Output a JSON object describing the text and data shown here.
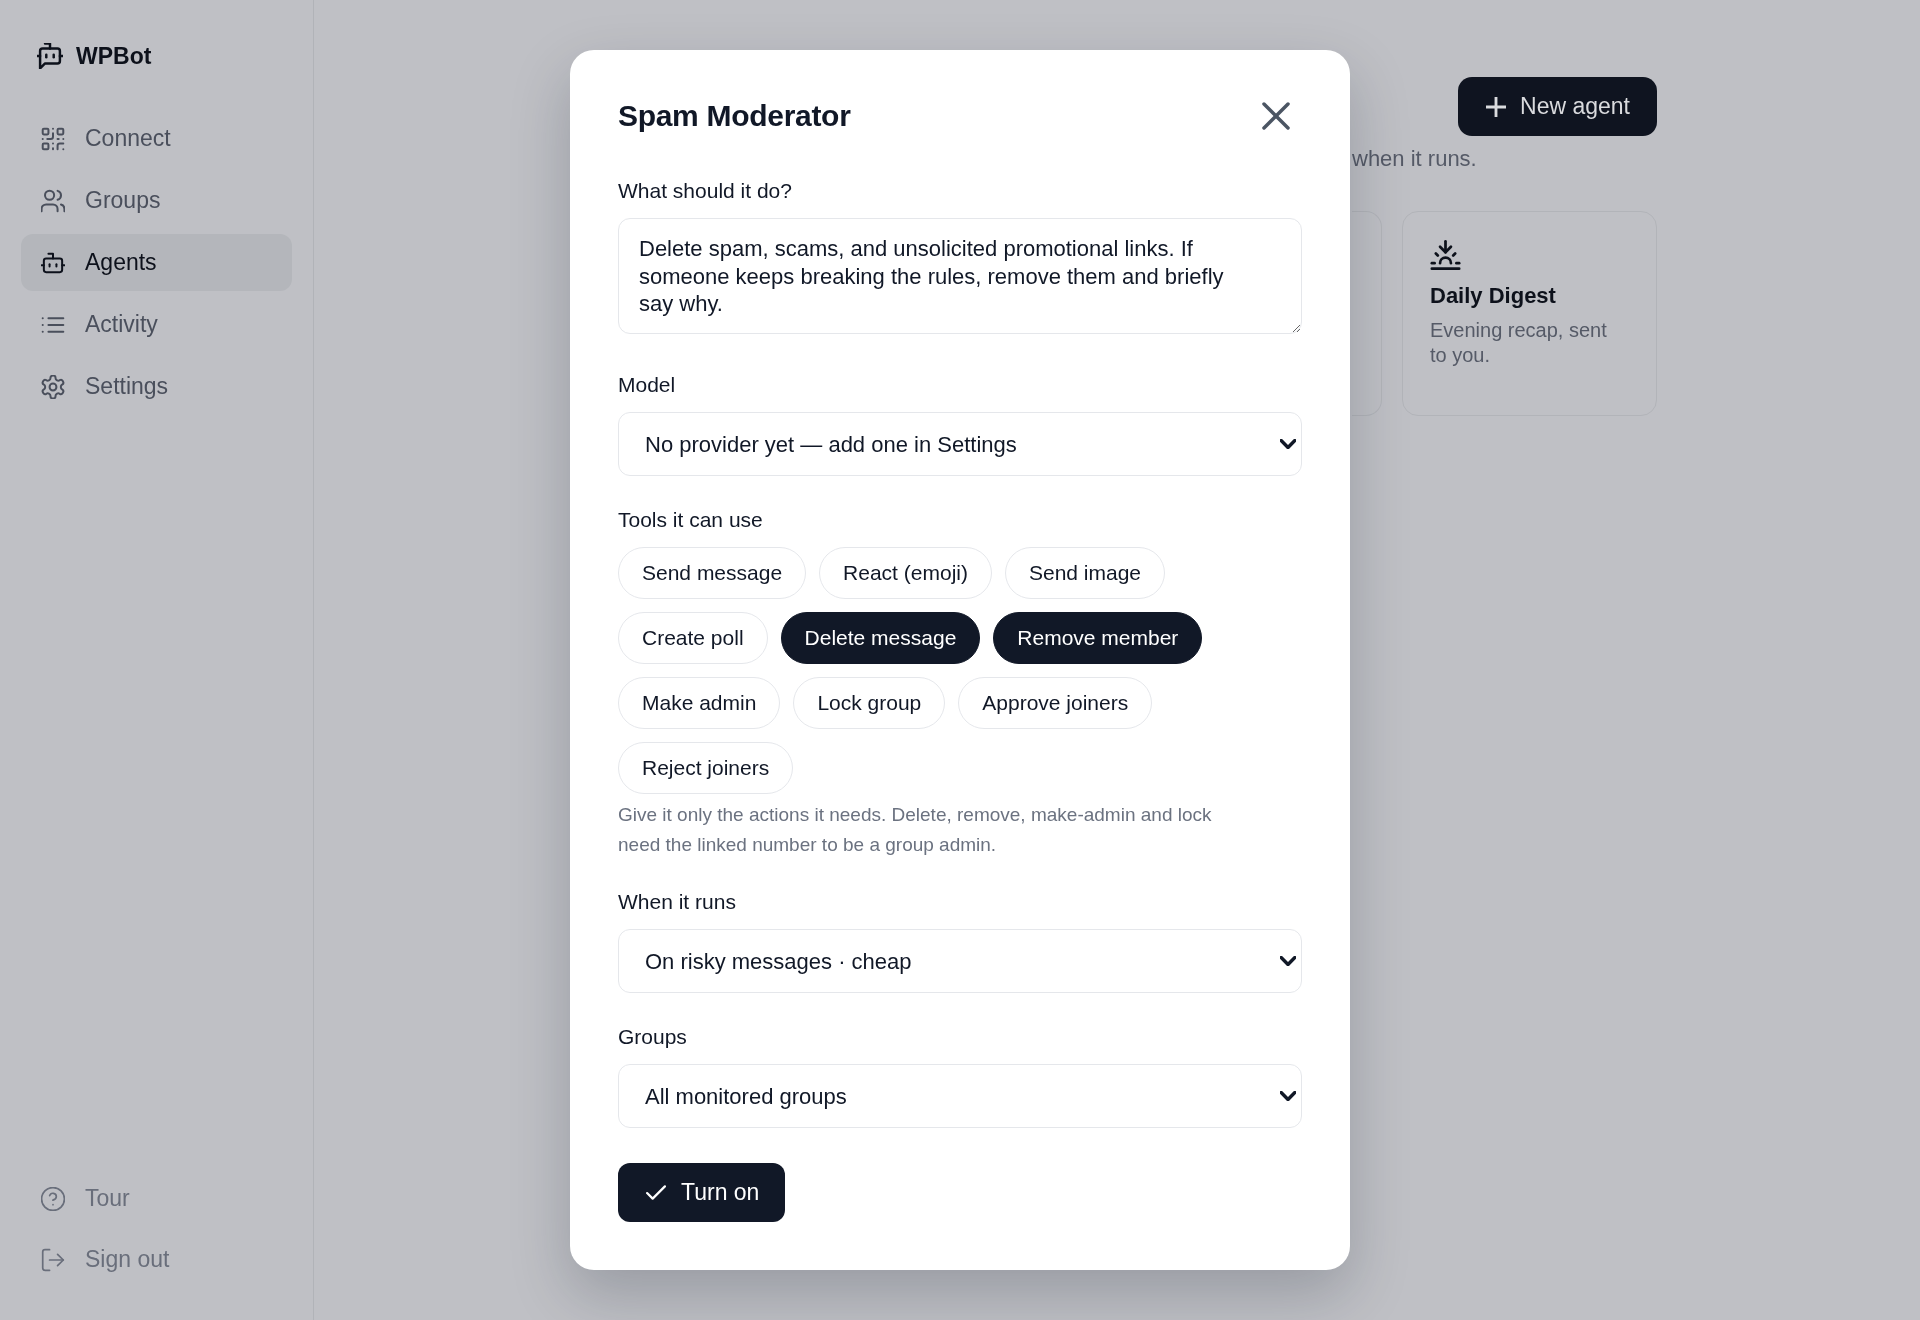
{
  "sidebar": {
    "brand": "WPBot",
    "nav": [
      {
        "label": "Connect",
        "selected": false
      },
      {
        "label": "Groups",
        "selected": false
      },
      {
        "label": "Agents",
        "selected": true
      },
      {
        "label": "Activity",
        "selected": false
      },
      {
        "label": "Settings",
        "selected": false
      }
    ],
    "footer": [
      {
        "label": "Tour"
      },
      {
        "label": "Sign out"
      }
    ]
  },
  "main": {
    "new_agent_button": "New agent",
    "subtitle": "when it runs.",
    "cards": [
      {
        "kind": "partial"
      },
      {
        "kind": "full",
        "title": "Daily Digest",
        "description": "Evening recap, sent to you."
      }
    ]
  },
  "dialog": {
    "title": "Spam Moderator",
    "instructions": {
      "label": "What should it do?",
      "value": "Delete spam, scams, and unsolicited promotional links. If someone keeps breaking the rules, remove them and briefly say why."
    },
    "model": {
      "label": "Model",
      "value": "No provider yet — add one in Settings"
    },
    "tools": {
      "label": "Tools it can use",
      "options": [
        {
          "label": "Send message",
          "selected": false
        },
        {
          "label": "React (emoji)",
          "selected": false
        },
        {
          "label": "Send image",
          "selected": false
        },
        {
          "label": "Create poll",
          "selected": false
        },
        {
          "label": "Delete message",
          "selected": true
        },
        {
          "label": "Remove member",
          "selected": true
        },
        {
          "label": "Make admin",
          "selected": false
        },
        {
          "label": "Lock group",
          "selected": false
        },
        {
          "label": "Approve joiners",
          "selected": false
        },
        {
          "label": "Reject joiners",
          "selected": false
        }
      ],
      "hint": "Give it only the actions it needs. Delete, remove, make-admin and lock need the linked number to be a group admin."
    },
    "schedule": {
      "label": "When it runs",
      "value": "On risky messages · cheap"
    },
    "groups": {
      "label": "Groups",
      "value": "All monitored groups"
    },
    "submit_button": "Turn on"
  }
}
